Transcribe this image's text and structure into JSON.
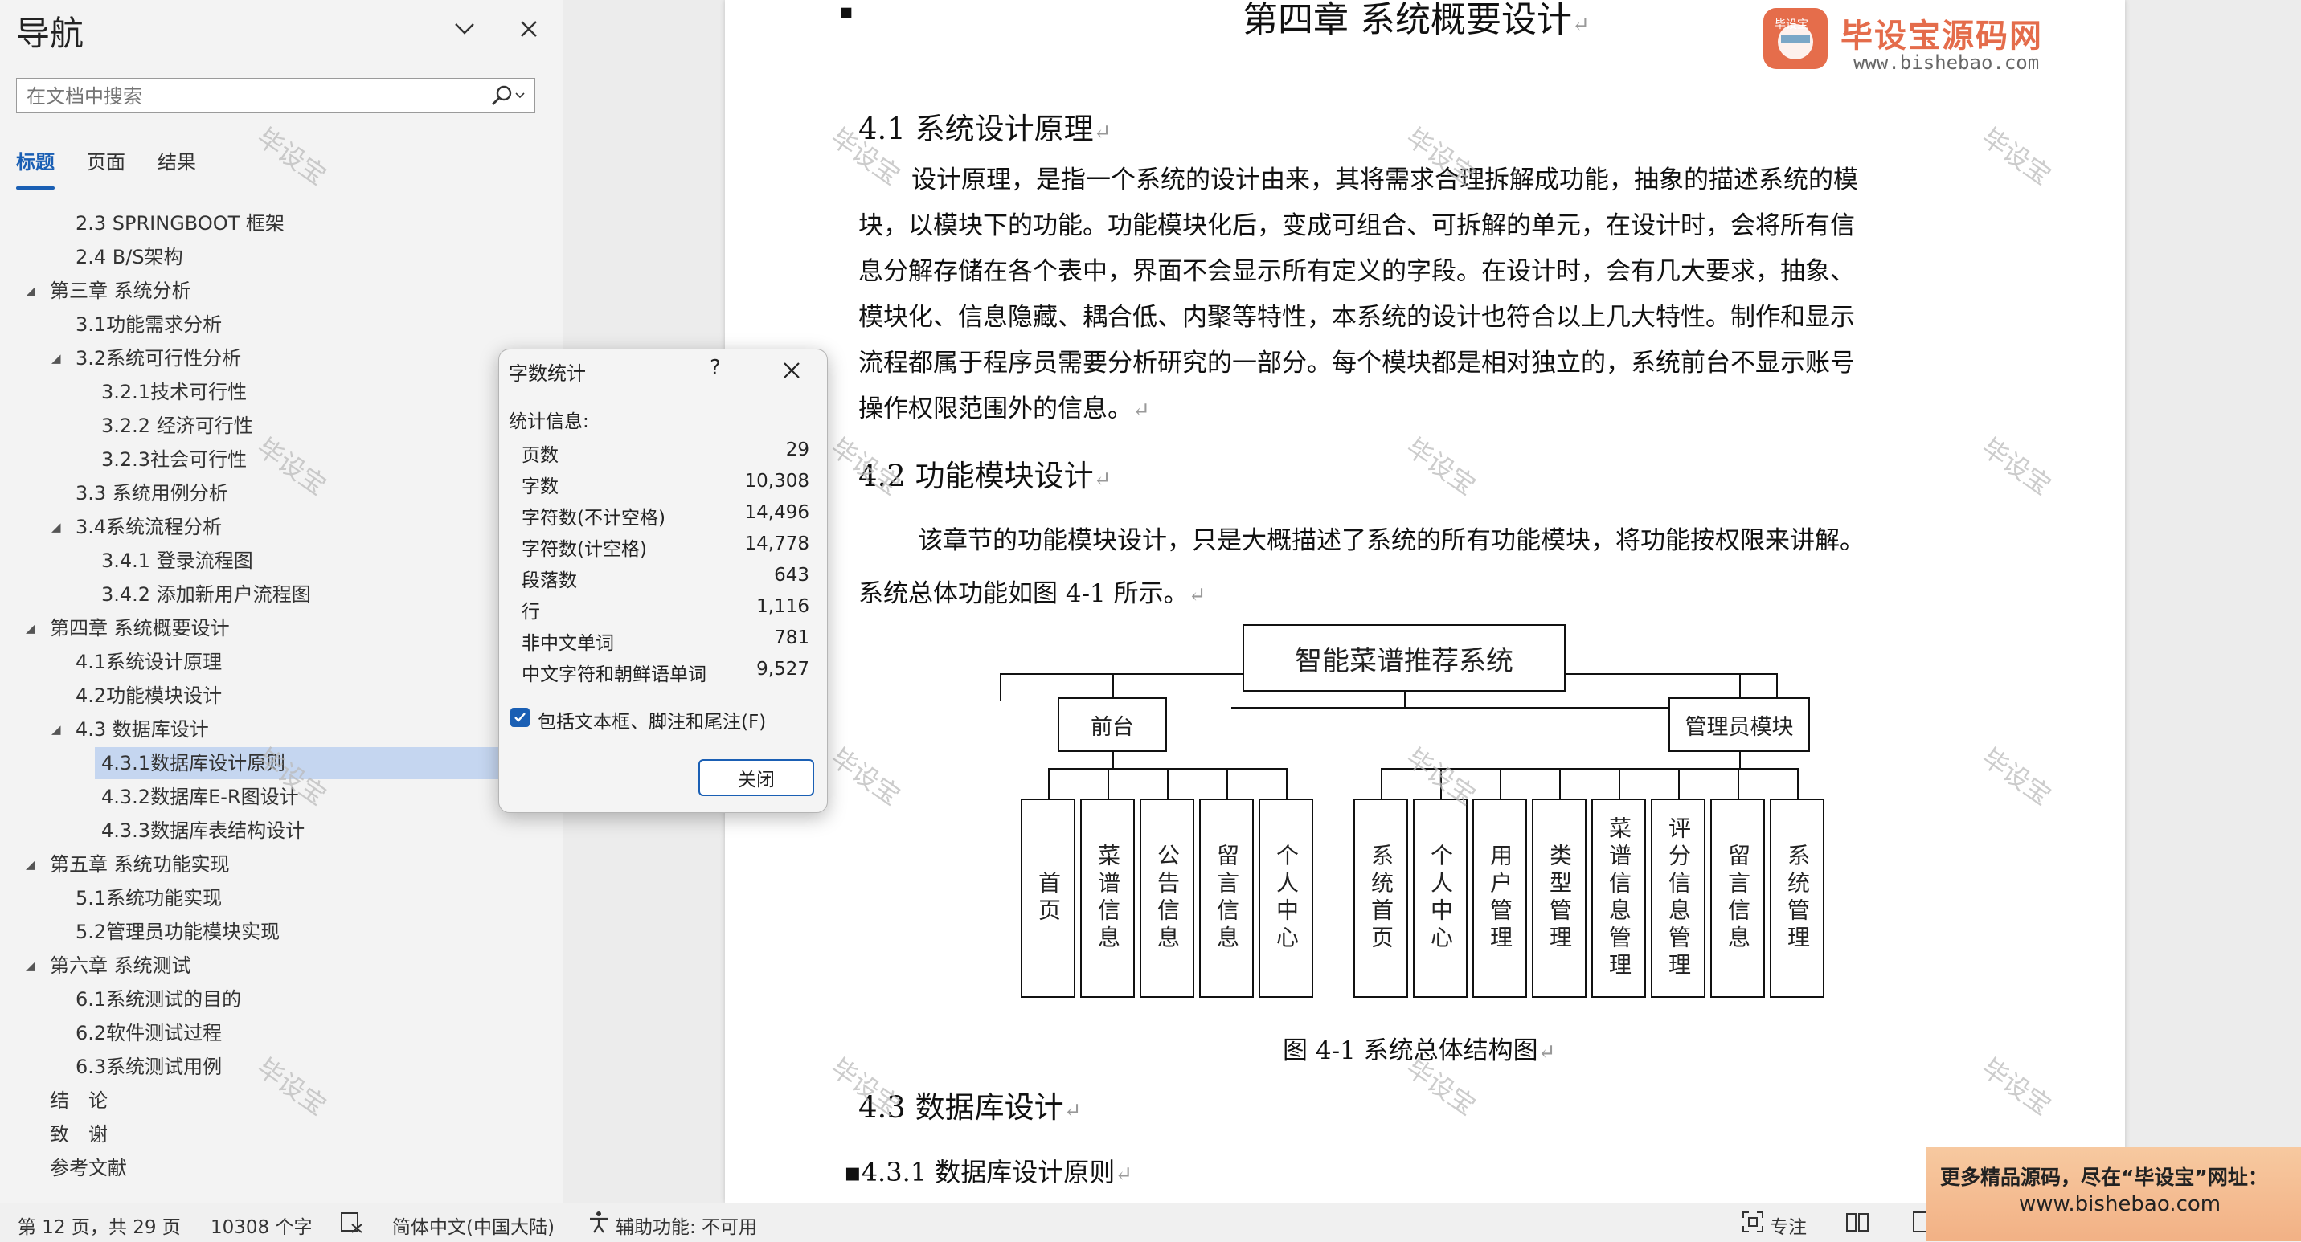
{
  "nav": {
    "title": "导航",
    "search_placeholder": "在文档中搜索",
    "tabs": [
      {
        "label": "标题",
        "active": true
      },
      {
        "label": "页面",
        "active": false
      },
      {
        "label": "结果",
        "active": false
      }
    ],
    "tree": [
      {
        "label": "2.3 SPRINGBOOT 框架",
        "level": 2,
        "expanded": null,
        "selected": false
      },
      {
        "label": "2.4 B/S架构",
        "level": 2,
        "expanded": null,
        "selected": false
      },
      {
        "label": "第三章 系统分析",
        "level": 1,
        "expanded": true,
        "selected": false
      },
      {
        "label": "3.1功能需求分析",
        "level": 2,
        "expanded": null,
        "selected": false
      },
      {
        "label": "3.2系统可行性分析",
        "level": 2,
        "expanded": true,
        "selected": false
      },
      {
        "label": "3.2.1技术可行性",
        "level": 3,
        "expanded": null,
        "selected": false
      },
      {
        "label": "3.2.2 经济可行性",
        "level": 3,
        "expanded": null,
        "selected": false
      },
      {
        "label": "3.2.3社会可行性",
        "level": 3,
        "expanded": null,
        "selected": false
      },
      {
        "label": "3.3 系统用例分析",
        "level": 2,
        "expanded": null,
        "selected": false
      },
      {
        "label": "3.4系统流程分析",
        "level": 2,
        "expanded": true,
        "selected": false
      },
      {
        "label": "3.4.1 登录流程图",
        "level": 3,
        "expanded": null,
        "selected": false
      },
      {
        "label": "3.4.2 添加新用户流程图",
        "level": 3,
        "expanded": null,
        "selected": false
      },
      {
        "label": "第四章 系统概要设计",
        "level": 1,
        "expanded": true,
        "selected": false
      },
      {
        "label": "4.1系统设计原理",
        "level": 2,
        "expanded": null,
        "selected": false
      },
      {
        "label": "4.2功能模块设计",
        "level": 2,
        "expanded": null,
        "selected": false
      },
      {
        "label": "4.3 数据库设计",
        "level": 2,
        "expanded": true,
        "selected": false
      },
      {
        "label": "4.3.1数据库设计原则",
        "level": 3,
        "expanded": null,
        "selected": true
      },
      {
        "label": "4.3.2数据库E-R图设计",
        "level": 3,
        "expanded": null,
        "selected": false
      },
      {
        "label": "4.3.3数据库表结构设计",
        "level": 3,
        "expanded": null,
        "selected": false
      },
      {
        "label": "第五章 系统功能实现",
        "level": 1,
        "expanded": true,
        "selected": false
      },
      {
        "label": "5.1系统功能实现",
        "level": 2,
        "expanded": null,
        "selected": false
      },
      {
        "label": "5.2管理员功能模块实现",
        "level": 2,
        "expanded": null,
        "selected": false
      },
      {
        "label": "第六章 系统测试",
        "level": 1,
        "expanded": true,
        "selected": false
      },
      {
        "label": "6.1系统测试的目的",
        "level": 2,
        "expanded": null,
        "selected": false
      },
      {
        "label": "6.2软件测试过程",
        "level": 2,
        "expanded": null,
        "selected": false
      },
      {
        "label": "6.3系统测试用例",
        "level": 2,
        "expanded": null,
        "selected": false
      },
      {
        "label": "结　论",
        "level": 1,
        "expanded": null,
        "selected": false
      },
      {
        "label": "致　谢",
        "level": 1,
        "expanded": null,
        "selected": false
      },
      {
        "label": "参考文献",
        "level": 1,
        "expanded": null,
        "selected": false
      }
    ]
  },
  "dialog": {
    "title": "字数统计",
    "help": "?",
    "section": "统计信息:",
    "stats": [
      {
        "label": "页数",
        "value": "29"
      },
      {
        "label": "字数",
        "value": "10,308"
      },
      {
        "label": "字符数(不计空格)",
        "value": "14,496"
      },
      {
        "label": "字符数(计空格)",
        "value": "14,778"
      },
      {
        "label": "段落数",
        "value": "643"
      },
      {
        "label": "行",
        "value": "1,116"
      },
      {
        "label": "非中文单词",
        "value": "781"
      },
      {
        "label": "中文字符和朝鲜语单词",
        "value": "9,527"
      }
    ],
    "checkbox_label": "包括文本框、脚注和尾注(F)",
    "checkbox_checked": true,
    "close_button": "关闭"
  },
  "document": {
    "chapter_heading": "第四章  系统概要设计",
    "h41": "4.1 系统设计原理",
    "p41_lines": [
      "设计原理，是指一个系统的设计由来，其将需求合理拆解成功能，抽象的描述系统的模",
      "块，以模块下的功能。功能模块化后，变成可组合、可拆解的单元，在设计时，会将所有信",
      "息分解存储在各个表中，界面不会显示所有定义的字段。在设计时，会有几大要求，抽象、",
      "模块化、信息隐藏、耦合低、内聚等特性，本系统的设计也符合以上几大特性。制作和显示",
      "流程都属于程序员需要分析研究的一部分。每个模块都是相对独立的，系统前台不显示账号",
      "操作权限范围外的信息。"
    ],
    "h42": "4.2 功能模块设计",
    "p42_lines": [
      "该章节的功能模块设计，只是大概描述了系统的所有功能模块，将功能按权限来讲解。",
      "系统总体功能如图 4-1 所示。"
    ],
    "diagram": {
      "root": "智能菜谱推荐系统",
      "branches": [
        {
          "name": "前台",
          "children": [
            "首页",
            "菜谱信息",
            "公告信息",
            "留言信息",
            "个人中心"
          ]
        },
        {
          "name": "管理员模块",
          "children": [
            "系统首页",
            "个人中心",
            "用户管理",
            "类型管理",
            "菜谱信息管理",
            "评分信息管理",
            "留言信息",
            "系统管理"
          ]
        }
      ]
    },
    "figure_caption": "图 4-1  系统总体结构图",
    "h43": "4.3  数据库设计",
    "h431": "4.3.1 数据库设计原则",
    "return_mark": "↵",
    "watermark": "毕设宝"
  },
  "logo": {
    "name": "毕设宝源码网",
    "url": "www.bishebao.com",
    "badge": "毕设宝"
  },
  "status": {
    "page": "第 12 页，共 29 页",
    "words": "10308 个字",
    "language": "简体中文(中国大陆)",
    "accessibility": "辅助功能: 不可用",
    "focus": "专注"
  },
  "ad": {
    "line1": "更多精品源码，尽在“毕设宝”网址：",
    "line2": "www.bishebao.com"
  },
  "colors": {
    "accent": "#1a5fb4",
    "selected_row": "#c5d6f0",
    "ad_bg": "#f2b185",
    "logo_red": "#e0532c"
  }
}
